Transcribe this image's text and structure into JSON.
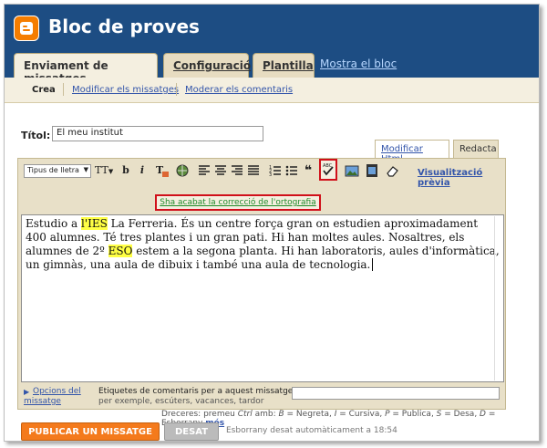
{
  "app": {
    "blog_title": "Bloc de proves"
  },
  "tabs": [
    {
      "label": "Enviament de missatges",
      "active": true
    },
    {
      "label": "Configuració",
      "active": false
    },
    {
      "label": "Plantilla",
      "active": false
    }
  ],
  "view_blog_link": "Mostra el  bloc",
  "subnav": {
    "create": "Crea",
    "edit_posts": "Modificar els missatges",
    "moderate": "Moderar els comentaris"
  },
  "post": {
    "title_label": "Títol:",
    "title_value": "El meu institut"
  },
  "mode_tabs": {
    "html": "Modificar Html",
    "compose": "Redacta"
  },
  "toolbar": {
    "font_select": "Tipus de lletra",
    "font_size": "TT",
    "bold": "b",
    "italic": "i",
    "preview": "Visualització prèvia"
  },
  "spellcheck_message": "Sha acabat la correcció de l'ortografia",
  "body": {
    "p1_a": "Estudio a ",
    "p1_hl1": "l'IES",
    "p1_b": " La Ferreria. És un centre força gran on estudien aproximadament 400 alumnes. Té tres plantes i un gran pati. Hi han moltes aules. Nosaltres, els alumnes de 2º ",
    "p1_hl2": "ESO",
    "p1_c": " estem a la segona planta. Hi han laboratoris, aules d'informàtica, un gimnàs, una aula de dibuix i també una aula de tecnologia."
  },
  "labels": {
    "options": "Opcions del missatge",
    "tags_label": "Etiquetes de comentaris per a aquest missatge:",
    "tags_hint": "per exemple, escúters, vacances, tardor"
  },
  "shortcuts": {
    "prefix": "Dreceres: premeu ",
    "ctrl": "Ctrl",
    "text": " amb: ",
    "b": "B",
    "b_t": " = Negreta, ",
    "i": "I",
    "i_t": " = Cursiva, ",
    "p": "P",
    "p_t": " = Publica, ",
    "s": "S",
    "s_t": " = Desa, ",
    "d": "D",
    "d_t": " = Esborrany ",
    "more": "més"
  },
  "actions": {
    "publish": "PUBLICAR UN MISSATGE",
    "save": "DESAT",
    "autosave": "Esborrany desat automàticament a 18:54"
  },
  "colors": {
    "header": "#1d4d83",
    "accent": "#f47a1c",
    "highlight_box": "#d0101a",
    "link": "#3355aa"
  }
}
